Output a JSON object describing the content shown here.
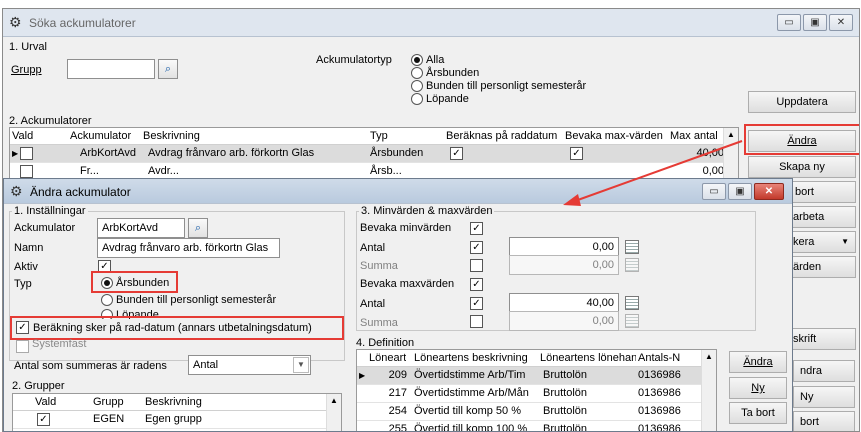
{
  "main": {
    "title": "Söka ackumulatorer",
    "urval": {
      "title": "1. Urval",
      "grupp_label": "Grupp",
      "grupp_value": ""
    },
    "typ": {
      "label": "Ackumulatortyp",
      "options": [
        "Alla",
        "Årsbunden",
        "Bunden till personligt semesterår",
        "Löpande"
      ],
      "selected": "Alla"
    },
    "uppdatera": "Uppdatera",
    "ack_section": "2. Ackumulatorer",
    "columns": [
      "Vald",
      "Ackumulator",
      "Beskrivning",
      "Typ",
      "Beräknas på raddatum",
      "Bevaka max-värden",
      "Max antal"
    ],
    "rows": [
      {
        "vald": false,
        "ack": "ArbKortAvd",
        "besk": "Avdrag frånvaro arb. förkortn Glas",
        "typ": "Årsbunden",
        "rad": true,
        "bevaka": true,
        "max": "40,00"
      },
      {
        "vald": false,
        "ack": "Fr...",
        "besk": "Avdr...",
        "typ": "Årsb...",
        "rad": false,
        "bevaka": false,
        "max": "0,00"
      }
    ],
    "right_buttons": [
      "Ändra",
      "Skapa ny",
      "bort",
      "arbeta",
      "kera",
      "ärden",
      "skrift"
    ],
    "bottom_buttons": [
      "ndra",
      "Ny",
      "bort"
    ]
  },
  "dialog": {
    "title": "Ändra ackumulator",
    "installningar": {
      "title": "1. Inställningar",
      "ack_label": "Ackumulator",
      "ack_value": "ArbKortAvd",
      "namn_label": "Namn",
      "namn_value": "Avdrag frånvaro arb. förkortn Glas",
      "aktiv_label": "Aktiv",
      "aktiv": true,
      "typ_label": "Typ",
      "typ_options": [
        "Årsbunden",
        "Bunden till personligt semesterår",
        "Löpande"
      ],
      "typ_selected": "Årsbunden"
    },
    "berakning": {
      "label": "Beräkning sker på rad-datum (annars utbetalningsdatum)",
      "checked": true
    },
    "systemfast": "Systemfast",
    "antal_summeras": {
      "label": "Antal som summeras är radens",
      "value": "Antal"
    },
    "grupper": {
      "title": "2. Grupper",
      "columns": [
        "Vald",
        "Grupp",
        "Beskrivning"
      ],
      "rows": [
        {
          "vald": true,
          "grupp": "EGEN",
          "besk": "Egen grupp"
        }
      ]
    },
    "minmax": {
      "title": "3. Minvärden & maxvärden",
      "bevaka_min": "Bevaka minvärden",
      "bevaka_min_checked": true,
      "min_antal_label": "Antal",
      "min_antal_checked": true,
      "min_antal_value": "0,00",
      "min_summa_label": "Summa",
      "min_summa_checked": false,
      "min_summa_value": "0,00",
      "bevaka_max": "Bevaka maxvärden",
      "bevaka_max_checked": true,
      "max_antal_label": "Antal",
      "max_antal_checked": true,
      "max_antal_value": "40,00",
      "max_summa_label": "Summa",
      "max_summa_checked": false,
      "max_summa_value": "0,00"
    },
    "definition": {
      "title": "4. Definition",
      "columns": [
        "Löneart",
        "Löneartens beskrivning",
        "Löneartens lönehantering",
        "Antals-N"
      ],
      "rows": [
        {
          "nr": "209",
          "besk": "Övertidstimme Arb/Tim",
          "lh": "Bruttolön",
          "an": "0136986"
        },
        {
          "nr": "217",
          "besk": "Övertidstimme Arb/Mån",
          "lh": "Bruttolön",
          "an": "0136986"
        },
        {
          "nr": "254",
          "besk": "Övertid till komp 50 %",
          "lh": "Bruttolön",
          "an": "0136986"
        },
        {
          "nr": "255",
          "besk": "Övertid till komp 100 %",
          "lh": "Bruttolön",
          "an": "0136986"
        }
      ],
      "buttons": [
        "Ändra",
        "Ny",
        "Ta bort"
      ]
    }
  },
  "icons": {
    "app": "gear-app-icon",
    "search": "search-icon",
    "calendar": "calendar-icon",
    "arrow": "annotation-arrow"
  },
  "colors": {
    "highlight": "#e53b35",
    "selected_row": "#cfd8e3"
  }
}
